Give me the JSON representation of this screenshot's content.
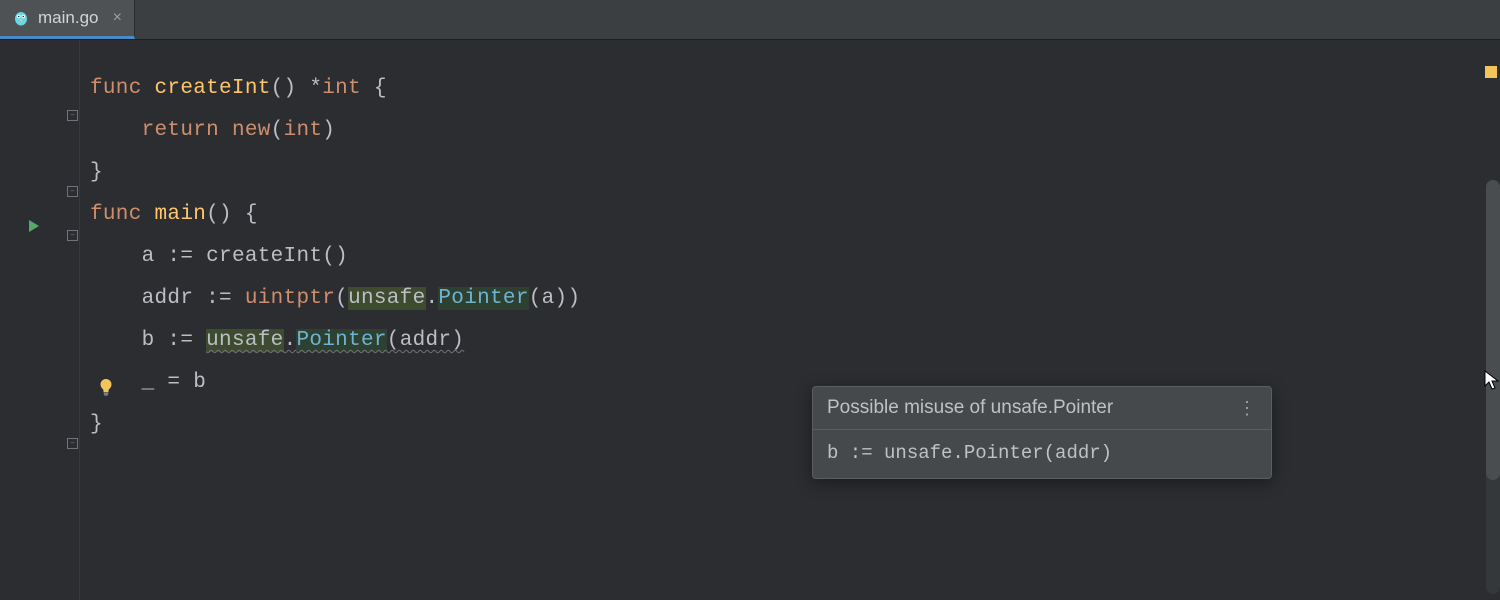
{
  "tab": {
    "filename": "main.go",
    "close_glyph": "×"
  },
  "code": {
    "lines": [
      {
        "segments": [
          {
            "t": "func ",
            "c": "kw"
          },
          {
            "t": "createInt",
            "c": "fn"
          },
          {
            "t": "() *",
            "c": "punct"
          },
          {
            "t": "int",
            "c": "kw"
          },
          {
            "t": " {",
            "c": "punct"
          }
        ]
      },
      {
        "indent": "    ",
        "segments": [
          {
            "t": "return ",
            "c": "kw"
          },
          {
            "t": "new",
            "c": "kw"
          },
          {
            "t": "(",
            "c": "punct"
          },
          {
            "t": "int",
            "c": "kw"
          },
          {
            "t": ")",
            "c": "punct"
          }
        ]
      },
      {
        "segments": [
          {
            "t": "}",
            "c": "punct"
          }
        ]
      },
      {
        "segments": [
          {
            "t": "func ",
            "c": "kw"
          },
          {
            "t": "main",
            "c": "fn"
          },
          {
            "t": "() {",
            "c": "punct"
          }
        ]
      },
      {
        "indent": "    ",
        "segments": [
          {
            "t": "a ",
            "c": "ident"
          },
          {
            "t": ":= ",
            "c": "op"
          },
          {
            "t": "createInt()",
            "c": "ident"
          }
        ]
      },
      {
        "indent": "    ",
        "segments": [
          {
            "t": "addr ",
            "c": "ident"
          },
          {
            "t": ":= ",
            "c": "op"
          },
          {
            "t": "uintptr",
            "c": "kw"
          },
          {
            "t": "(",
            "c": "punct"
          },
          {
            "t": "unsafe",
            "c": "ident hl-call"
          },
          {
            "t": ".",
            "c": "punct"
          },
          {
            "t": "Pointer",
            "c": "type hl-call2"
          },
          {
            "t": "(a))",
            "c": "punct"
          }
        ]
      },
      {
        "indent": "    ",
        "highlight": true,
        "segments": [
          {
            "t": "b ",
            "c": "ident"
          },
          {
            "t": ":= ",
            "c": "op"
          },
          {
            "t": "unsafe",
            "c": "ident hl-call wavy"
          },
          {
            "t": ".",
            "c": "punct wavy"
          },
          {
            "t": "Pointer",
            "c": "type hl-call2 wavy"
          },
          {
            "t": "(addr)",
            "c": "punct wavy"
          }
        ]
      },
      {
        "indent": "    ",
        "segments": [
          {
            "t": "_ ",
            "c": "ident"
          },
          {
            "t": "= ",
            "c": "op"
          },
          {
            "t": "b",
            "c": "ident"
          }
        ]
      },
      {
        "segments": [
          {
            "t": "}",
            "c": "punct"
          }
        ]
      }
    ]
  },
  "tooltip": {
    "title": "Possible misuse of unsafe.Pointer",
    "body": "b := unsafe.Pointer(addr)",
    "menu_glyph": "⋮"
  },
  "gutter": {
    "fold_glyph": "–"
  },
  "colors": {
    "marker_green": "#59a869",
    "marker_gray": "#6f737a"
  }
}
